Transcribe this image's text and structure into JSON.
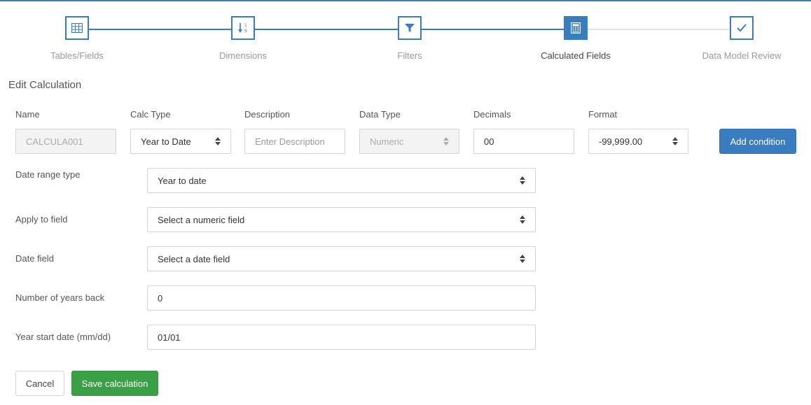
{
  "wizard": {
    "steps": [
      {
        "label": "Tables/Fields",
        "icon": "table-grid-icon",
        "state": "done"
      },
      {
        "label": "Dimensions",
        "icon": "sort-numeric-icon",
        "state": "done"
      },
      {
        "label": "Filters",
        "icon": "filter-icon",
        "state": "done"
      },
      {
        "label": "Calculated Fields",
        "icon": "calculator-icon",
        "state": "active"
      },
      {
        "label": "Data Model Review",
        "icon": "check-icon",
        "state": "pending"
      }
    ],
    "colors": {
      "accent": "#3a7cc0",
      "inactive_line": "#e3e3e3"
    }
  },
  "section_title": "Edit Calculation",
  "fields": {
    "name": {
      "label": "Name",
      "placeholder": "CALCULA001"
    },
    "calc_type": {
      "label": "Calc Type",
      "value": "Year to Date"
    },
    "description": {
      "label": "Description",
      "placeholder": "Enter Description"
    },
    "data_type": {
      "label": "Data Type",
      "value": "Numeric"
    },
    "decimals": {
      "label": "Decimals",
      "value": "00"
    },
    "format": {
      "label": "Format",
      "value": "-99,999.00"
    }
  },
  "add_condition_label": "Add condition",
  "rows": {
    "date_range_type": {
      "label": "Date range type",
      "value": "Year to date"
    },
    "apply_to_field": {
      "label": "Apply to field",
      "value": "Select a numeric field"
    },
    "date_field": {
      "label": "Date field",
      "value": "Select a date field"
    },
    "years_back": {
      "label": "Number of years back",
      "value": "0"
    },
    "year_start": {
      "label": "Year start date (mm/dd)",
      "value": "01/01"
    }
  },
  "buttons": {
    "cancel": "Cancel",
    "save": "Save calculation"
  },
  "colors": {
    "primary": "#3a7cc0",
    "success": "#3aa045"
  }
}
